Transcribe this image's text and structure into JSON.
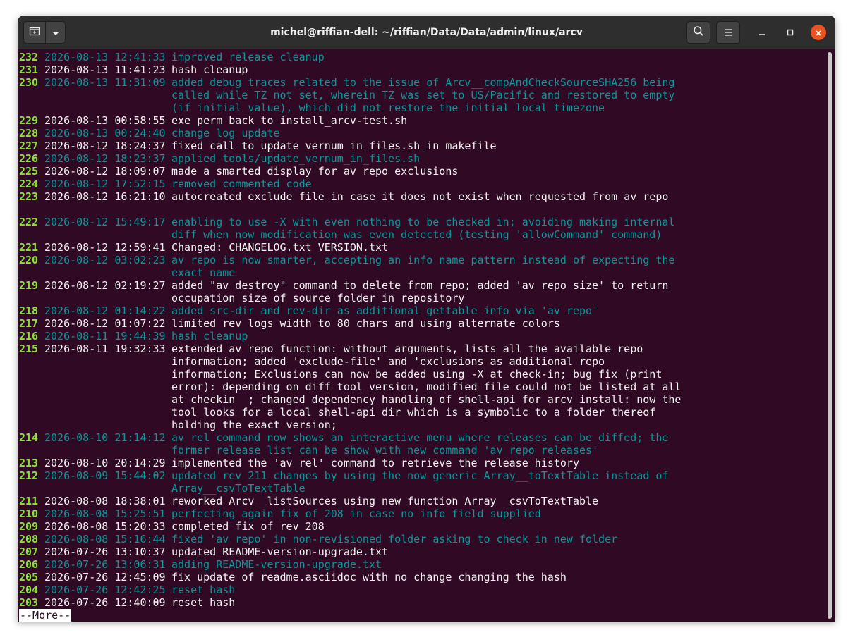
{
  "window": {
    "title": "michel@riffian-dell: ~/riffian/Data/Data/admin/linux/arcv"
  },
  "icons": {
    "new_tab": "new-tab-icon",
    "dropdown": "chevron-down-icon",
    "search": "search-icon",
    "menu": "hamburger-menu-icon",
    "minimize": "minimize-icon",
    "maximize": "maximize-icon",
    "close": "close-icon"
  },
  "colors": {
    "terminal_bg": "#300a24",
    "rev_number": "#8ae234",
    "text_white": "#f2f2f2",
    "text_teal": "#06989a",
    "close_button": "#e95420"
  },
  "entries": [
    {
      "num": "232",
      "date": "2026-08-13 12:41:33",
      "color": "teal",
      "lines": [
        "improved release cleanup"
      ]
    },
    {
      "num": "231",
      "date": "2026-08-13 11:41:23",
      "color": "white",
      "lines": [
        "hash cleanup"
      ]
    },
    {
      "num": "230",
      "date": "2026-08-13 11:31:09",
      "color": "teal",
      "lines": [
        "added debug traces related to the issue of Arcv__compAndCheckSourceSHA256 being",
        "called while TZ not set, wherein TZ was set to US/Pacific and restored to empty",
        "(if initial value), which did not restore the initial local timezone"
      ]
    },
    {
      "num": "229",
      "date": "2026-08-13 00:58:55",
      "color": "white",
      "lines": [
        "exe perm back to install_arcv-test.sh"
      ]
    },
    {
      "num": "228",
      "date": "2026-08-13 00:24:40",
      "color": "teal",
      "lines": [
        "change log update"
      ]
    },
    {
      "num": "227",
      "date": "2026-08-12 18:24:37",
      "color": "white",
      "lines": [
        "fixed call to update_vernum_in_files.sh in makefile"
      ]
    },
    {
      "num": "226",
      "date": "2026-08-12 18:23:37",
      "color": "teal",
      "lines": [
        "applied tools/update_vernum_in_files.sh"
      ]
    },
    {
      "num": "225",
      "date": "2026-08-12 18:09:07",
      "color": "white",
      "lines": [
        "made a smarted display for av repo exclusions"
      ]
    },
    {
      "num": "224",
      "date": "2026-08-12 17:52:15",
      "color": "teal",
      "lines": [
        "removed commented code"
      ]
    },
    {
      "num": "223",
      "date": "2026-08-12 16:21:10",
      "color": "white",
      "lines": [
        "autocreated exclude file in case it does not exist when requested from av repo",
        ""
      ]
    },
    {
      "num": "222",
      "date": "2026-08-12 15:49:17",
      "color": "teal",
      "lines": [
        "enabling to use -X with even nothing to be checked in; avoiding making internal",
        "diff when now modification was even detected (testing 'allowCommand' command)"
      ]
    },
    {
      "num": "221",
      "date": "2026-08-12 12:59:41",
      "color": "white",
      "lines": [
        "Changed: CHANGELOG.txt VERSION.txt"
      ]
    },
    {
      "num": "220",
      "date": "2026-08-12 03:02:23",
      "color": "teal",
      "lines": [
        "av repo is now smarter, accepting an info name pattern instead of expecting the",
        "exact name"
      ]
    },
    {
      "num": "219",
      "date": "2026-08-12 02:19:27",
      "color": "white",
      "lines": [
        "added \"av destroy\" command to delete from repo; added 'av repo size' to return",
        "occupation size of source folder in repository"
      ]
    },
    {
      "num": "218",
      "date": "2026-08-12 01:14:22",
      "color": "teal",
      "lines": [
        "added src-dir and rev-dir as additional gettable info via 'av repo'"
      ]
    },
    {
      "num": "217",
      "date": "2026-08-12 01:07:22",
      "color": "white",
      "lines": [
        "limited rev logs width to 80 chars and using alternate colors"
      ]
    },
    {
      "num": "216",
      "date": "2026-08-11 19:44:39",
      "color": "teal",
      "lines": [
        "hash cleanup"
      ]
    },
    {
      "num": "215",
      "date": "2026-08-11 19:32:33",
      "color": "white",
      "lines": [
        "extended av repo function: without arguments, lists all the available repo",
        "information; added 'exclude-file' and 'exclusions as additional repo",
        "information; Exclusions can now be added using -X at check-in; bug fix (print",
        "error): depending on diff tool version, modified file could not be listed at all",
        "at checkin  ; changed dependency handling of shell-api for arcv install: now the",
        "tool looks for a local shell-api dir which is a symbolic to a folder thereof",
        "holding the exact version;"
      ]
    },
    {
      "num": "214",
      "date": "2026-08-10 21:14:12",
      "color": "teal",
      "lines": [
        "av rel command now shows an interactive menu where releases can be diffed; the",
        "former release list can be show with new command 'av repo releases'"
      ]
    },
    {
      "num": "213",
      "date": "2026-08-10 20:14:29",
      "color": "white",
      "lines": [
        "implemented the 'av rel' command to retrieve the release history"
      ]
    },
    {
      "num": "212",
      "date": "2026-08-09 15:44:02",
      "color": "teal",
      "lines": [
        "updated rev 211 changes by using the now generic Array__toTextTable instead of",
        "Array__csvToTextTable"
      ]
    },
    {
      "num": "211",
      "date": "2026-08-08 18:38:01",
      "color": "white",
      "lines": [
        "reworked Arcv__listSources using new function Array__csvToTextTable"
      ]
    },
    {
      "num": "210",
      "date": "2026-08-08 15:25:51",
      "color": "teal",
      "lines": [
        "perfecting again fix of 208 in case no info field supplied"
      ]
    },
    {
      "num": "209",
      "date": "2026-08-08 15:20:33",
      "color": "white",
      "lines": [
        "completed fix of rev 208"
      ]
    },
    {
      "num": "208",
      "date": "2026-08-08 15:16:44",
      "color": "teal",
      "lines": [
        "fixed 'av repo' in non-revisioned folder asking to check in new folder"
      ]
    },
    {
      "num": "207",
      "date": "2026-07-26 13:10:37",
      "color": "white",
      "lines": [
        "updated README-version-upgrade.txt"
      ]
    },
    {
      "num": "206",
      "date": "2026-07-26 13:06:31",
      "color": "teal",
      "lines": [
        "adding README-version-upgrade.txt"
      ]
    },
    {
      "num": "205",
      "date": "2026-07-26 12:45:09",
      "color": "white",
      "lines": [
        "fix update of readme.asciidoc with no change changing the hash"
      ]
    },
    {
      "num": "204",
      "date": "2026-07-26 12:42:25",
      "color": "teal",
      "lines": [
        "reset hash"
      ]
    },
    {
      "num": "203",
      "date": "2026-07-26 12:40:09",
      "color": "white",
      "lines": [
        "reset hash"
      ]
    }
  ],
  "pager_prompt": "--More--"
}
